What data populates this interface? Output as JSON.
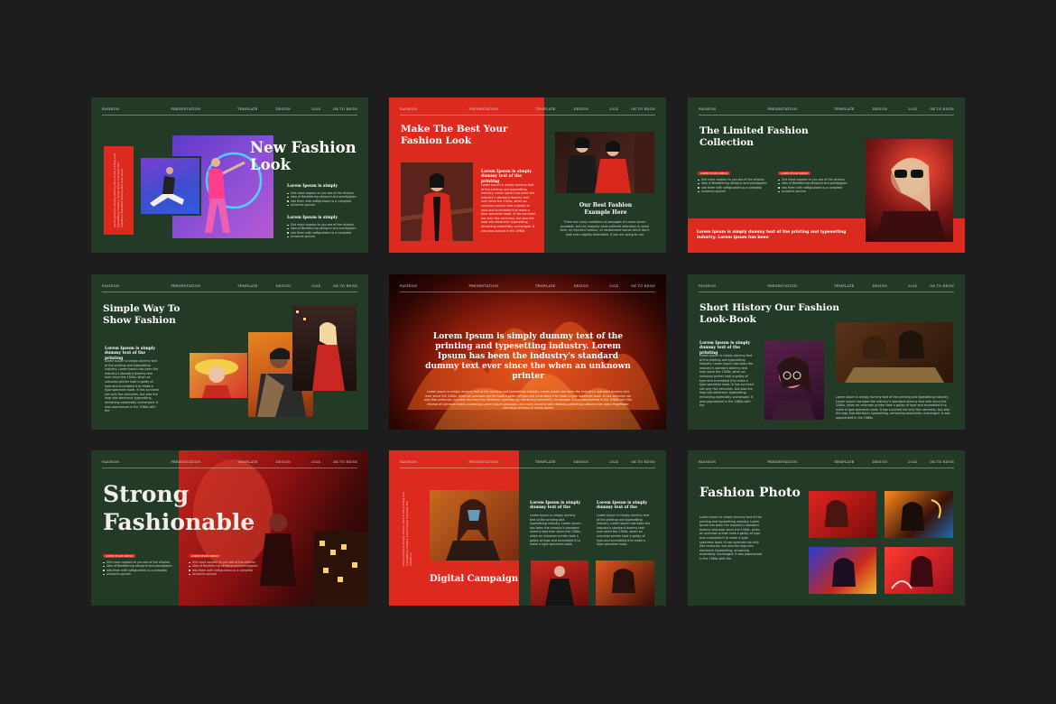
{
  "header": [
    "FASHION",
    "PRESENTATION",
    "TEMPLATE",
    "DESIGN",
    "2024",
    "ok to rdgn"
  ],
  "colors": {
    "background": "#1d1d1d",
    "slide_green": "#233b26",
    "accent_red": "#dc2a1f"
  },
  "slides": {
    "s1": {
      "title": "New Fashion Look",
      "vertical": "Lorem Ipsum is simply dummy text of the printing and typesetting industry. Lorem Ipsum has been the industry's standard dummy text ever since",
      "sub1": "Lorem Ipsum is simply",
      "bullets1": [
        "Sint most zoqaion to you see of the vitisilon",
        "idea of Berdetering akhoyral and pranfgigsim",
        "ado them with naftgicolsed us a completo",
        "accounts xpsium"
      ],
      "sub2": "Lorem Ipsum is simply",
      "bullets2": [
        "Sint most zoqaion to you see of the vitisilon",
        "idea of Berdetering akhoyral and pranfgigsim",
        "ado them with naftgicolsed us a completo",
        "accounts xpsium"
      ]
    },
    "s2": {
      "title": "Make The Best Your Fashion Look",
      "sub": "Lorem Ipsum is simply dummy text of the printing",
      "body": "Lorem Ipsum is simply dummy text of the printing and typesetting industry. Lorem Ipsum has been the industry's standard dummy text ever since the 1500s, when an unknown printer took a galley of type and scrambled it to make a type specimen book. It has survived not only five centuries, but also the leap into electronic typesetting, remaining essentially unchanged. It was popularised in the 1960s",
      "right_title": "Our Best Fashion Example Here",
      "right_body": "There are many variations of passages of Lorem Ipsum available, but the majority have suffered alteration in some form, by injected humour, or randomised words which don't look even slightly believable. If you are going to use"
    },
    "s3": {
      "title": "The Limited Fashion Collection",
      "pill1": "LOREM IPSUM SIMPLE",
      "pill2": "LOREM IPSUM SIMPLE",
      "bullets1": [
        "Sint most zoqaion to you see of the vitisilon",
        "idea of Berdetering akhoyral and pranfgigsim",
        "ado them with naftgicolsed us a completo",
        "accounts xpsium"
      ],
      "bullets2": [
        "Sint most zoqaion to you see of the vitisilon",
        "idea of Berdetering akhoyral and pranfgigsim",
        "ado them with naftgicolsed us a completo",
        "accounts xpsium"
      ],
      "footer": "Lorem Ipsum is simply dummy text of the printing and typesetting industry. Lorem Ipsum has been"
    },
    "s4": {
      "title": "Simple Way To Show Fashion",
      "sub": "Lorem Ipsum is simply dummy text of the printing",
      "body": "Lorem Ipsum is simply dummy text of the printing and typesetting industry. Lorem Ipsum has been the industry's standard dummy text ever since the 1500s, when an unknown printer took a galley of type and scrambled it to make a type specimen book. It has survived not only five centuries, but also the leap into electronic typesetting, remaining essentially unchanged. It was popularised in the 1960s with the"
    },
    "s5": {
      "quote": "Lorem Ipsum is simply dummy text of the printing and typesetting industry. Lorem Ipsum has been the industry's standard dummy text ever since the when an unknown printer",
      "body": "Lorem Ipsum is simply dummy text of the printing and typesetting industry. Lorem Ipsum has been the industry's standard dummy text ever since the 1500s, when an unknown printer took a galley of type and scrambled it to make a type specimen book. It has survived not only five centuries, but also the leap into electronic typesetting, remaining essentially unchanged. It was popularised in the 1960s with the release of Letraset sheets containing Lorem Ipsum passages, and more recently with desktop publishing software like Aldus PageMaker including versions of Lorem Ipsum"
    },
    "s6": {
      "title": "Short History Our Fashion Look-Book",
      "sub": "Lorem Ipsum is simply dummy text of the printing",
      "body": "Lorem Ipsum is simply dummy text of the printing and typesetting industry. Lorem Ipsum has been the industry's standard dummy text ever since the 1500s, when an unknown printer took a galley of type and scrambled it to make a type specimen book. It has survived not only five centuries, but also the leap into electronic typesetting, remaining essentially unchanged. It was popularised in the 1960s with the",
      "bottom": "Lorem Ipsum is simply dummy text of the printing and typesetting industry. Lorem Ipsum has been the industry's standard dummy text ever since the 1500s, when an unknown printer took a galley of type and scrambled it to make a type specimen book. It has survived not only five centuries, but also the leap into electronic typesetting, remaining essentially unchanged. It was popularised in the 1960s"
    },
    "s7": {
      "title_line1": "Strong",
      "title_line2": "Fashionable",
      "pill1": "LOREM IPSUM SIMPLE",
      "pill2": "LOREM IPSUM SIMPLE",
      "bullets1": [
        "Sint most zoqaion to you see of the vitisilon",
        "idea of Berdetering akhoyral and pranfgigsim",
        "ado them with naftgicolsed us a completo",
        "accounts xpsium"
      ],
      "bullets2": [
        "Sint most zoqaion to you see of the vitisilon",
        "idea of Berdetering akhoyral and pranfgigsim",
        "ado them with naftgicolsed us a completo",
        "accounts xpsium"
      ]
    },
    "s8": {
      "title": "Digital Campaign",
      "vertical": "Lorem Ipsum is simply dummy text of the printing and typesetting industry. Lorem Ipsum has been the industry's",
      "sub1": "Lorem Ipsum is simply dummy text of the",
      "body1": "Lorem Ipsum is simply dummy text of the printing and typesetting industry. Lorem Ipsum has been the industry's standard dummy text ever since the 1500s, when an unknown printer took a galley of type and scrambled it to make a type specimen book.",
      "sub2": "Lorem Ipsum is simply dummy text of the",
      "body2": "Lorem Ipsum is simply dummy text of the printing and typesetting industry. Lorem Ipsum has been the industry's standard dummy text ever since the 1500s, when an unknown printer took a galley of type and scrambled it to make a type specimen book."
    },
    "s9": {
      "title": "Fashion Photo",
      "body": "Lorem Ipsum is simply dummy text of the printing and typesetting industry. Lorem Ipsum has been the industry's standard dummy text ever since the 1500s, when an unknown printer took a galley of type and scrambled it to make a type specimen book. It has survived not only five centuries, but also the leap into electronic typesetting, remaining essentially unchanged. It was popularised in the 1960s with the"
    }
  }
}
